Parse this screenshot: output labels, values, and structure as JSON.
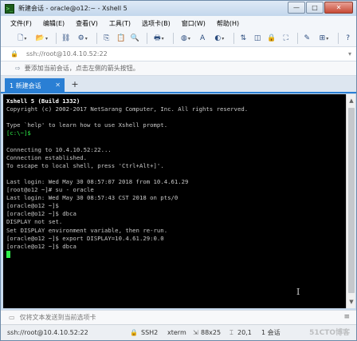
{
  "window": {
    "title": "新建会话 - oracle@o12:~ - Xshell 5",
    "min_glyph": "—",
    "max_glyph": "□",
    "close_glyph": "✕"
  },
  "menu": [
    "文件(F)",
    "编辑(E)",
    "查看(V)",
    "工具(T)",
    "选项卡(B)",
    "窗口(W)",
    "帮助(H)"
  ],
  "toolbar_icons": [
    "new-session-icon",
    "open-folder-icon",
    "disconnect-icon",
    "properties-icon",
    "copy-icon",
    "paste-icon",
    "find-icon",
    "print-icon",
    "globe-icon",
    "font-icon",
    "color-icon",
    "xftp-icon",
    "transparency-icon",
    "lock-icon",
    "fullscreen-icon",
    "compose-icon",
    "add-icon",
    "help-icon"
  ],
  "address": {
    "value": "ssh://root@10.4.10.52:22"
  },
  "hint": {
    "text": "要添加当前会话，点击左侧的箭头按钮。"
  },
  "tabs": [
    {
      "label": "1 新建会话",
      "active": true
    }
  ],
  "terminal": {
    "background": "#000000",
    "prompt_color": "#2ff04a",
    "lines": [
      {
        "text": "Xshell 5 (Build 1332)",
        "style": "bold"
      },
      {
        "text": "Copyright (c) 2002-2017 NetSarang Computer, Inc. All rights reserved.",
        "style": "normal"
      },
      {
        "text": "",
        "style": "normal"
      },
      {
        "text": "Type `help' to learn how to use Xshell prompt.",
        "style": "normal"
      },
      {
        "text": "[c:\\~]$",
        "style": "green"
      },
      {
        "text": "",
        "style": "normal"
      },
      {
        "text": "Connecting to 10.4.10.52:22...",
        "style": "normal"
      },
      {
        "text": "Connection established.",
        "style": "normal"
      },
      {
        "text": "To escape to local shell, press 'Ctrl+Alt+]'.",
        "style": "normal"
      },
      {
        "text": "",
        "style": "normal"
      },
      {
        "text": "Last login: Wed May 30 08:57:07 2018 from 10.4.61.29",
        "style": "normal"
      },
      {
        "text": "[root@o12 ~]# su - oracle",
        "style": "normal"
      },
      {
        "text": "Last login: Wed May 30 08:57:43 CST 2018 on pts/0",
        "style": "normal"
      },
      {
        "text": "[oracle@o12 ~]$",
        "style": "normal"
      },
      {
        "text": "[oracle@o12 ~]$ dbca",
        "style": "normal"
      },
      {
        "text": "DISPLAY not set.",
        "style": "normal"
      },
      {
        "text": "Set DISPLAY environment variable, then re-run.",
        "style": "normal"
      },
      {
        "text": "[oracle@o12 ~]$ export DISPLAY=10.4.61.29:0.0",
        "style": "normal"
      },
      {
        "text": "[oracle@o12 ~]$ dbca",
        "style": "normal"
      }
    ]
  },
  "sendbar": {
    "label": "仅将文本发送到当前选项卡"
  },
  "status": {
    "connection": "ssh://root@10.4.10.52:22",
    "protocol": "SSH2",
    "terminal": "xterm",
    "size": "88x25",
    "cursor": "20,1",
    "sessions": "1 会话"
  },
  "watermark": "51CTO博客"
}
